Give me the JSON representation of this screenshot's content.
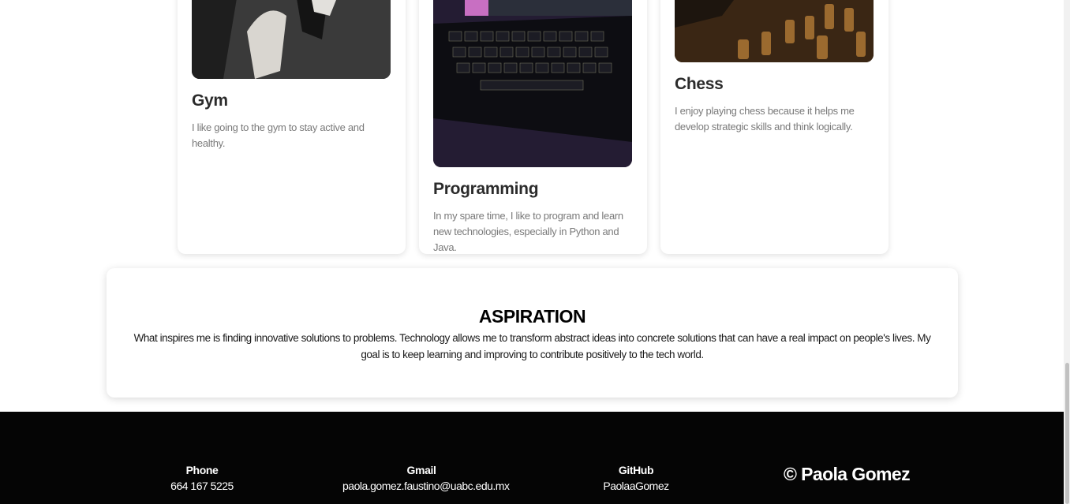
{
  "hobbies": [
    {
      "title": "Gym",
      "description": "I like going to the gym to stay active and healthy.",
      "image_icon": "gym-photo"
    },
    {
      "title": "Programming",
      "description": "In my spare time, I like to program and learn new technologies, especially in Python and Java.",
      "image_icon": "laptop-photo"
    },
    {
      "title": "Chess",
      "description": "I enjoy playing chess because it helps me develop strategic skills and think logically.",
      "image_icon": "chess-photo"
    }
  ],
  "aspiration": {
    "title": "ASPIRATION",
    "text": "What inspires me is finding innovative solutions to problems. Technology allows me to transform abstract ideas into concrete solutions that can have a real impact on people's lives. My goal is to keep learning and improving to contribute positively to the tech world."
  },
  "footer": {
    "phone": {
      "label": "Phone",
      "value": "664 167 5225"
    },
    "gmail": {
      "label": "Gmail",
      "value": "paola.gomez.faustino@uabc.edu.mx"
    },
    "github": {
      "label": "GitHub",
      "value": "PaolaaGomez"
    },
    "copyright": "© Paola Gomez"
  },
  "colors": {
    "footer_bg": "#050505",
    "card_bg": "#ffffff",
    "text_muted": "#7a7a7a"
  }
}
